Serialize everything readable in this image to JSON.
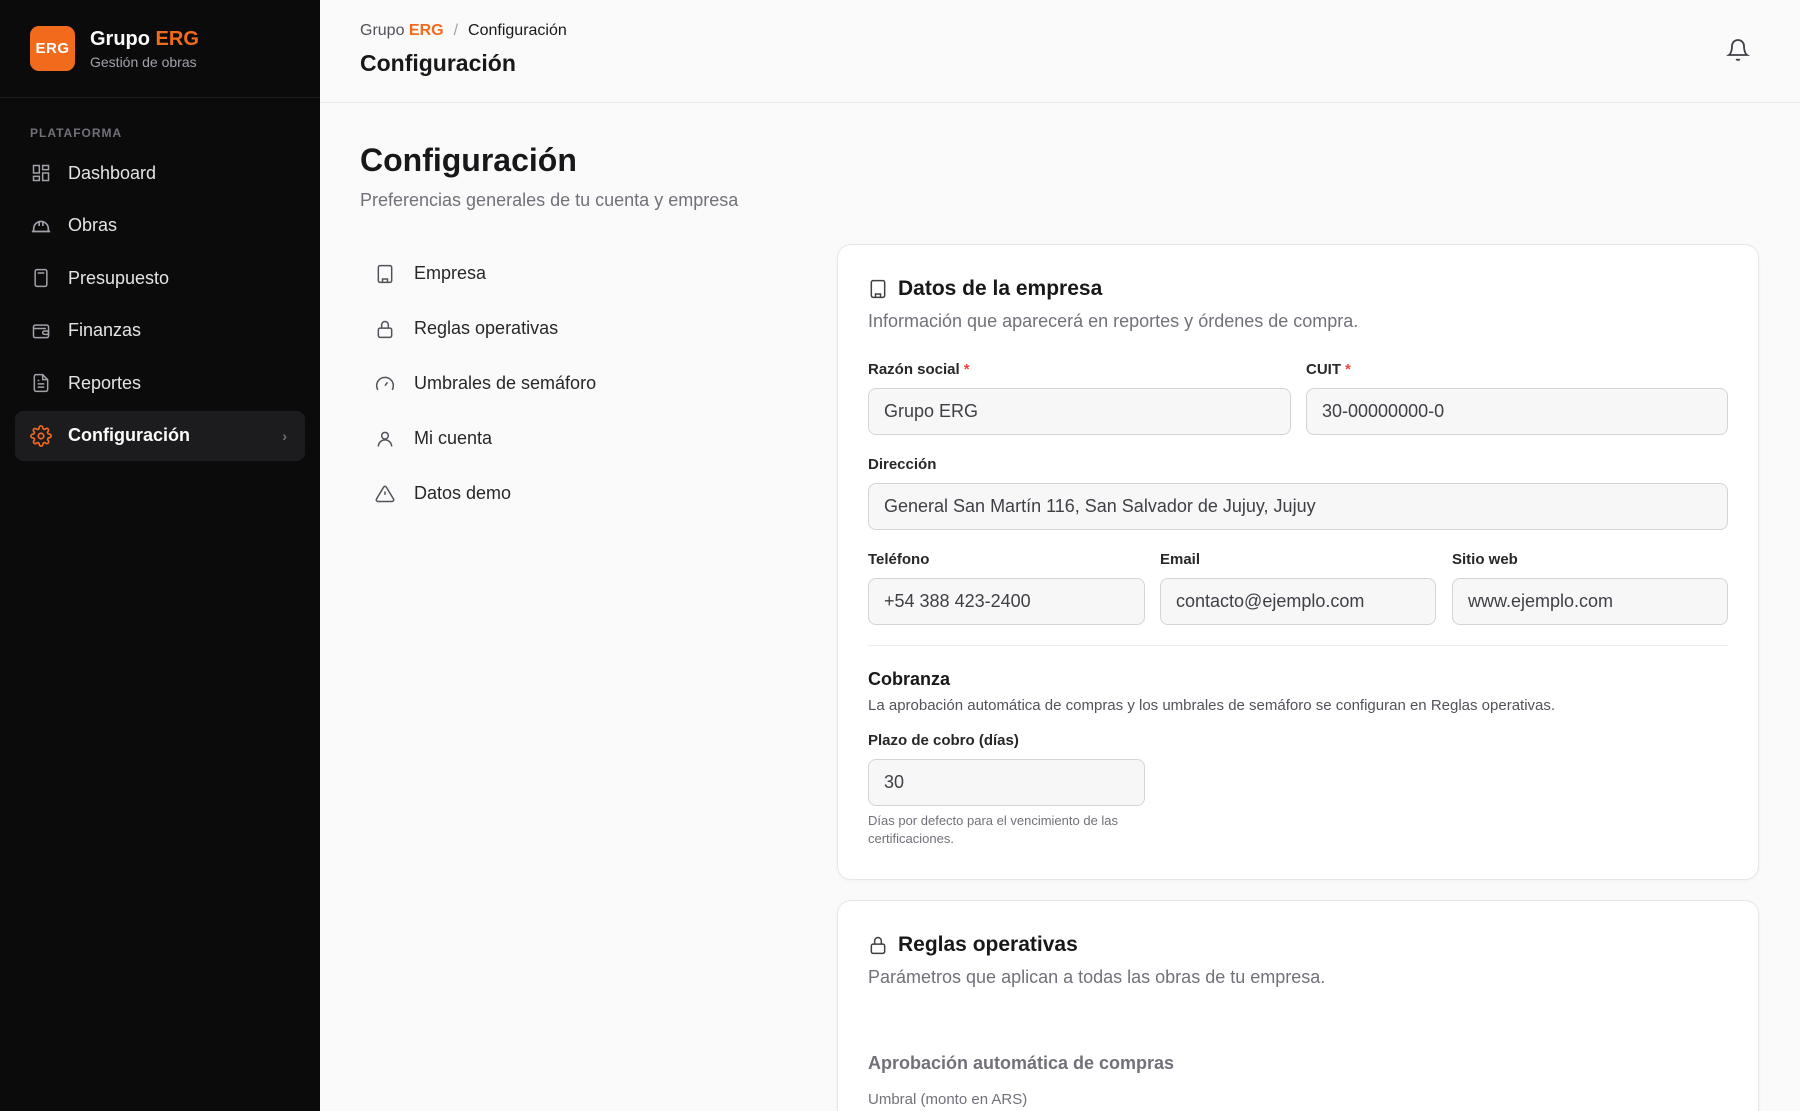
{
  "brand": {
    "logo": "ERG",
    "name_prefix": "Grupo ",
    "name_accent": "ERG",
    "subtitle": "Gestión de obras",
    "accent_color": "#f26b1d"
  },
  "sidebar": {
    "section": "PLATAFORMA",
    "items": [
      {
        "label": "Dashboard",
        "icon": "grid-icon"
      },
      {
        "label": "Obras",
        "icon": "hardhat-icon"
      },
      {
        "label": "Presupuesto",
        "icon": "calculator-icon"
      },
      {
        "label": "Finanzas",
        "icon": "wallet-icon"
      },
      {
        "label": "Reportes",
        "icon": "file-text-icon"
      },
      {
        "label": "Configuración",
        "icon": "gear-icon",
        "active": true
      }
    ]
  },
  "topbar": {
    "breadcrumb": {
      "root_prefix": "Grupo ",
      "root_accent": "ERG",
      "separator": "/",
      "current": "Configuración"
    },
    "title": "Configuración"
  },
  "page": {
    "title": "Configuración",
    "subtitle": "Preferencias generales de tu cuenta y empresa"
  },
  "subnav": [
    {
      "label": "Empresa",
      "icon": "building-icon"
    },
    {
      "label": "Reglas operativas",
      "icon": "lock-icon"
    },
    {
      "label": "Umbrales de semáforo",
      "icon": "gauge-icon"
    },
    {
      "label": "Mi cuenta",
      "icon": "user-icon"
    },
    {
      "label": "Datos demo",
      "icon": "warning-icon"
    }
  ],
  "company": {
    "title": "Datos de la empresa",
    "description": "Información que aparecerá en reportes y órdenes de compra.",
    "razon_social": {
      "label": "Razón social",
      "value": "Grupo ERG"
    },
    "cuit": {
      "label": "CUIT",
      "value": "30-00000000-0"
    },
    "required_mark": "*",
    "direccion": {
      "label": "Dirección",
      "value": "General San Martín 116, San Salvador de Jujuy, Jujuy"
    },
    "telefono": {
      "label": "Teléfono",
      "value": "+54 388 423-2400"
    },
    "email": {
      "label": "Email",
      "value": "contacto@ejemplo.com"
    },
    "web": {
      "label": "Sitio web",
      "value": "www.ejemplo.com"
    },
    "cobranza": {
      "title": "Cobranza",
      "description": "La aprobación automática de compras y los umbrales de semáforo se configuran en Reglas operativas.",
      "plazo_label": "Plazo de cobro (días)",
      "plazo_value": "30",
      "plazo_help": "Días por defecto para el vencimiento de las certificaciones."
    }
  },
  "rules": {
    "title": "Reglas operativas",
    "description": "Parámetros que aplican a todas las obras de tu empresa.",
    "auto_title": "Aprobación automática de compras",
    "threshold_label": "Umbral (monto en ARS)"
  }
}
